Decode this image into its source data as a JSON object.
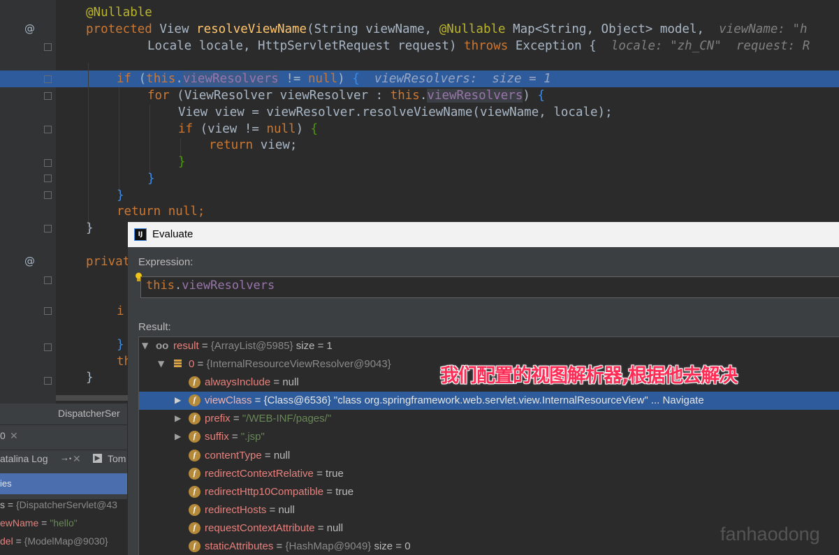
{
  "code": {
    "line1": "@Nullable",
    "line2_kw": "protected ",
    "line2_type": "View ",
    "line2_fn": "resolveViewName",
    "line2_rest": "(String viewName, ",
    "line2_ann": "@Nullable ",
    "line2_rest2": "Map<String, Object> model,",
    "line2_hint": "  viewName: \"h",
    "line3_a": "Locale locale, HttpServletRequest request) ",
    "line3_kw": "throws ",
    "line3_b": "Exception {",
    "line3_hint": "  locale: \"zh_CN\"  request: R",
    "line4_kw": "if ",
    "line4_a": "(",
    "line4_this": "this",
    "line4_dot": ".",
    "line4_field": "viewResolvers",
    "line4_b": " != ",
    "line4_null": "null",
    "line4_c": ") ",
    "line4_brace": "{",
    "line4_hint": "  viewResolvers:  size = 1",
    "line5_kw": "for ",
    "line5_a": "(ViewResolver viewResolver : ",
    "line5_this": "this",
    "line5_dot": ".",
    "line5_field": "viewResolvers",
    "line5_b": ") ",
    "line5_brace": "{",
    "line6": "View view = viewResolver.resolveViewName(viewName, locale);",
    "line7_kw": "if ",
    "line7_a": "(view != ",
    "line7_null": "null",
    "line7_b": ") ",
    "line7_brace": "{",
    "line8_kw": "return ",
    "line8_a": "view;",
    "line9": "}",
    "line10": "}",
    "line11": "}",
    "line12_kw": "return ",
    "line12_null": "null",
    "line12_semi": ";",
    "line13": "}",
    "line14_kw": "privat",
    "line15_kw": "i",
    "line16": "}",
    "line17_kw": "th",
    "line18": "}"
  },
  "gutter": {
    "override_icon_1": "@",
    "override_icon_2": "@"
  },
  "bottom_panel": {
    "file_tab": "DispatcherSer",
    "counter": "0",
    "catalina_log": "atalina Log",
    "tomcat": "Tom",
    "variables_header": "ies",
    "var1_rest": "s = ",
    "var1_val": "{DispatcherServlet@43",
    "var2_name": "ewName",
    "var2_eq": " = ",
    "var2_val": "\"hello\"",
    "var3_name": "del",
    "var3_eq": " = ",
    "var3_val": "{ModelMap@9030}"
  },
  "evaluate": {
    "title": "Evaluate",
    "logo_text": "IJ",
    "expression_label": "Expression:",
    "expression_this": "this",
    "expression_dot": ".",
    "expression_field": "viewResolvers",
    "result_label": "Result:",
    "rows": [
      {
        "name": "result",
        "eq": " = ",
        "val": "{ArrayList@5985}",
        "extra": "  size = 1"
      },
      {
        "name": "0",
        "eq": " = ",
        "val": "{InternalResourceViewResolver@9043}",
        "extra": ""
      },
      {
        "name": "alwaysInclude",
        "eq": " = ",
        "val": "null",
        "extra": ""
      },
      {
        "name": "viewClass",
        "eq": " = ",
        "val": "{Class@6536}",
        "extra": " \"class org.springframework.web.servlet.view.InternalResourceView\" ... Navigate"
      },
      {
        "name": "prefix",
        "eq": " = ",
        "val": "\"/WEB-INF/pages/\"",
        "extra": ""
      },
      {
        "name": "suffix",
        "eq": " = ",
        "val": "\".jsp\"",
        "extra": ""
      },
      {
        "name": "contentType",
        "eq": " = ",
        "val": "null",
        "extra": ""
      },
      {
        "name": "redirectContextRelative",
        "eq": " = ",
        "val": "true",
        "extra": ""
      },
      {
        "name": "redirectHttp10Compatible",
        "eq": " = ",
        "val": "true",
        "extra": ""
      },
      {
        "name": "redirectHosts",
        "eq": " = ",
        "val": "null",
        "extra": ""
      },
      {
        "name": "requestContextAttribute",
        "eq": " = ",
        "val": "null",
        "extra": ""
      },
      {
        "name": "staticAttributes",
        "eq": " = ",
        "val": "{HashMap@9049}",
        "extra": "  size = 0"
      }
    ]
  },
  "annotation_text": "我们配置的视图解析器,根据他去解决",
  "watermark": "fanhaodong",
  "colors": {
    "editor_bg": "#2b2b2b",
    "selection": "#2d5b9b",
    "keyword": "#cc7832",
    "field": "#9876aa",
    "annotation": "#ff2d55"
  }
}
